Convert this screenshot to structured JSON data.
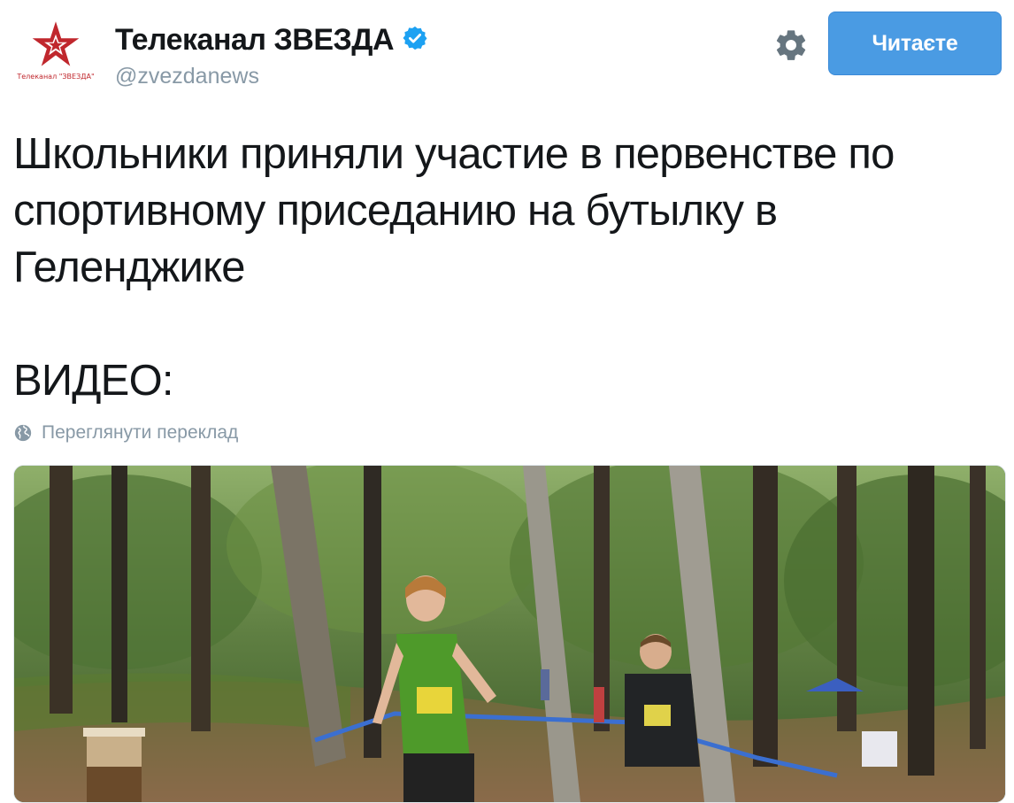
{
  "account": {
    "display_name": "Телеканал ЗВЕЗДА",
    "handle": "@zvezdanews",
    "verified": true,
    "avatar_caption": "Телеканал \"ЗВЕЗДА\"",
    "avatar_icon": "red-star-logo"
  },
  "actions": {
    "settings_icon": "gear-icon",
    "follow_label": "Читаєте"
  },
  "tweet": {
    "lines": [
      "Школьники приняли участие в первенстве по",
      "спортивному приседанию на бутылку в",
      "Геленджике"
    ],
    "video_label": "ВИДЕО:"
  },
  "translate": {
    "icon": "globe-icon",
    "label": "Переглянути переклад"
  },
  "media": {
    "type": "photo",
    "description_icon": "forest-race-photo"
  },
  "colors": {
    "accent": "#4a9be3",
    "muted": "#8899a6",
    "text": "#14171a",
    "brand_red": "#c0272d"
  }
}
